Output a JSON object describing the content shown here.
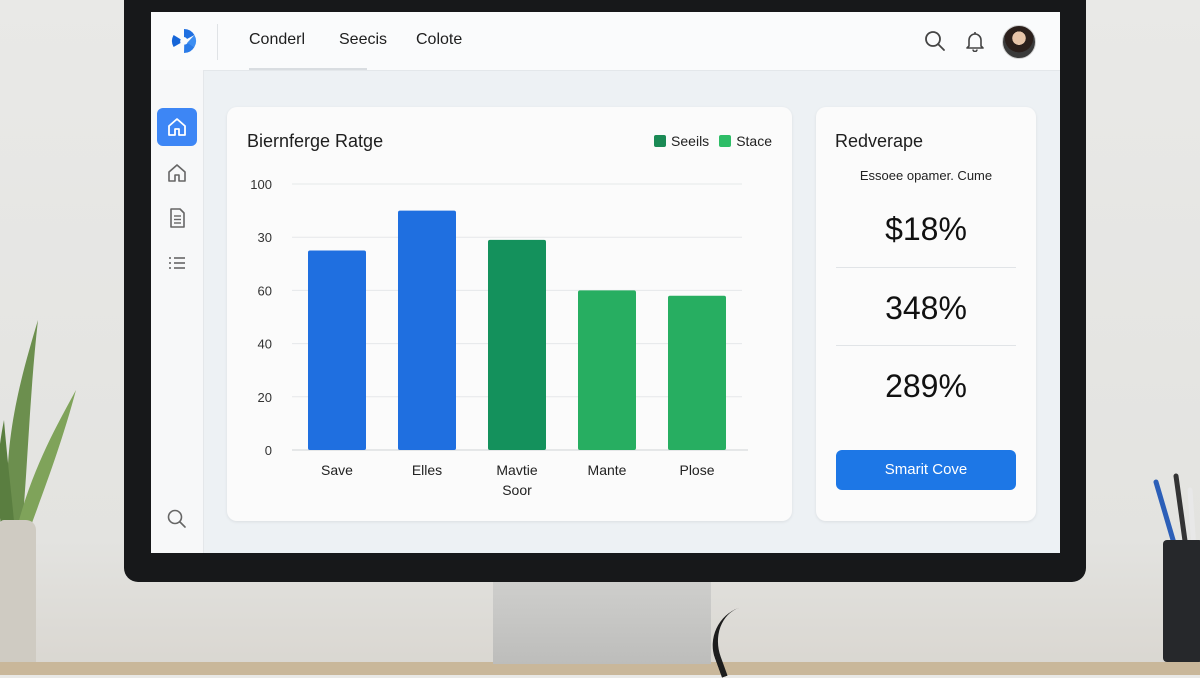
{
  "header": {
    "nav": [
      "Conderl",
      "Seecis",
      "Colote"
    ],
    "icons": [
      "search-icon",
      "bell-icon"
    ]
  },
  "sidebar": {
    "icons": [
      "home-icon",
      "home-outline-icon",
      "document-icon",
      "list-icon",
      "search-icon"
    ],
    "active_index": 0
  },
  "chart_panel": {
    "title": "Biernferge Ratge",
    "legend": [
      {
        "label": "Seeils",
        "color": "#1a8a55"
      },
      {
        "label": "Stace",
        "color": "#2ebd67"
      }
    ]
  },
  "chart_data": {
    "type": "bar",
    "title": "Biernferge Ratge",
    "categories": [
      "Save",
      "Elles",
      "Mavtie Soor",
      "Mante",
      "Plose"
    ],
    "category_lines": [
      [
        "Save"
      ],
      [
        "Elles"
      ],
      [
        "Mavtie",
        "Soor"
      ],
      [
        "Mante"
      ],
      [
        "Plose"
      ]
    ],
    "values": [
      75,
      90,
      79,
      60,
      58
    ],
    "colors": [
      "#1f6fe0",
      "#1f6fe0",
      "#14915c",
      "#27ae61",
      "#27ae61"
    ],
    "ytick_labels": [
      "0",
      "20",
      "40",
      "60",
      "30",
      "100"
    ],
    "ytick_values": [
      0,
      20,
      40,
      60,
      80,
      100
    ],
    "ylim": [
      0,
      100
    ],
    "grid": true
  },
  "stats_panel": {
    "title": "Redverape",
    "subtitle": "Essoee opamer. Cume",
    "values": [
      "$18%",
      "348%",
      "289%"
    ],
    "button_label": "Smarit Cove",
    "accent": "#1d77e6"
  }
}
